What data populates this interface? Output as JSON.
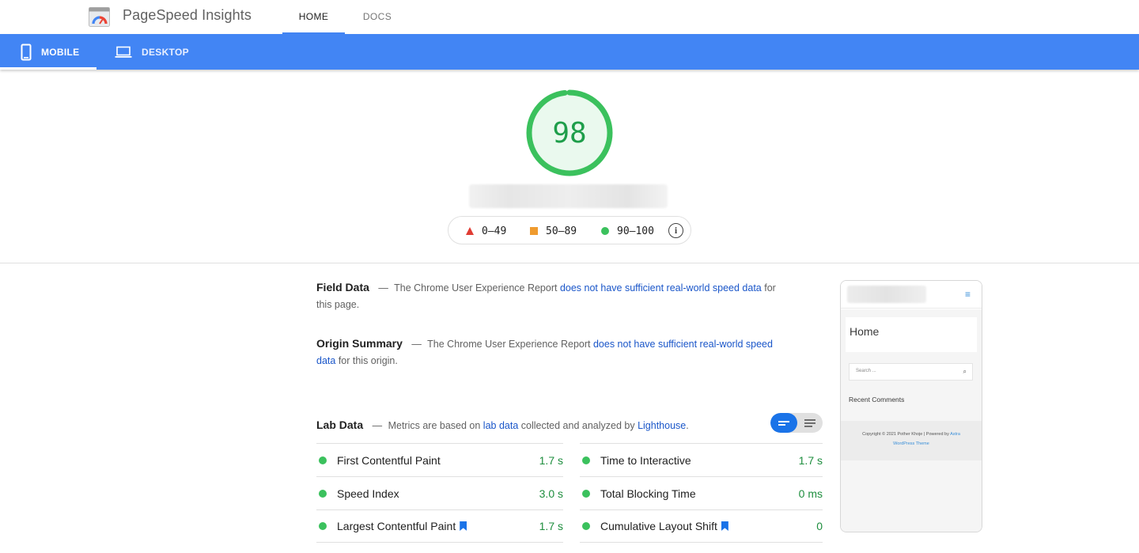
{
  "header": {
    "app_title": "PageSpeed Insights",
    "tabs": [
      {
        "label": "HOME",
        "active": true
      },
      {
        "label": "DOCS",
        "active": false
      }
    ]
  },
  "device_tabs": [
    {
      "label": "MOBILE",
      "icon": "smartphone-icon",
      "active": true
    },
    {
      "label": "DESKTOP",
      "icon": "laptop-icon",
      "active": false
    }
  ],
  "score": {
    "value": "98",
    "fraction": 0.98,
    "color": "#0cce6b"
  },
  "legend": {
    "ranges": [
      {
        "label": "0–49",
        "shape": "triangle",
        "color": "#e03c33"
      },
      {
        "label": "50–89",
        "shape": "square",
        "color": "#ef9b2f"
      },
      {
        "label": "90–100",
        "shape": "circle",
        "color": "#3bc15d"
      }
    ],
    "info_icon": "info-icon"
  },
  "field_data": {
    "heading": "Field Data",
    "dash": "—",
    "text_before": "The Chrome User Experience Report ",
    "link": "does not have sufficient real-world speed data",
    "text_after": " for this page."
  },
  "origin_summary": {
    "heading": "Origin Summary",
    "dash": "—",
    "text_before": "The Chrome User Experience Report ",
    "link": "does not have sufficient real-world speed data",
    "text_after": " for this origin."
  },
  "lab_data": {
    "heading": "Lab Data",
    "dash": "—",
    "text_before": "Metrics are based on ",
    "link1": "lab data",
    "text_mid": " collected and analyzed by ",
    "link2": "Lighthouse",
    "text_after": "."
  },
  "metrics_left": [
    {
      "name": "First Contentful Paint",
      "value": "1.7 s",
      "bookmark": false
    },
    {
      "name": "Speed Index",
      "value": "3.0 s",
      "bookmark": false
    },
    {
      "name": "Largest Contentful Paint",
      "value": "1.7 s",
      "bookmark": true
    }
  ],
  "metrics_right": [
    {
      "name": "Time to Interactive",
      "value": "1.7 s",
      "bookmark": false
    },
    {
      "name": "Total Blocking Time",
      "value": "0 ms",
      "bookmark": false
    },
    {
      "name": "Cumulative Layout Shift",
      "value": "0",
      "bookmark": true
    }
  ],
  "preview": {
    "page_title": "Home",
    "search_placeholder": "Search ...",
    "recent_comments": "Recent Comments",
    "footer_line1": "Copyright © 2021 Pother Khoje | Powered by ",
    "footer_link1": "Astra",
    "footer_link2": "WordPress Theme"
  }
}
